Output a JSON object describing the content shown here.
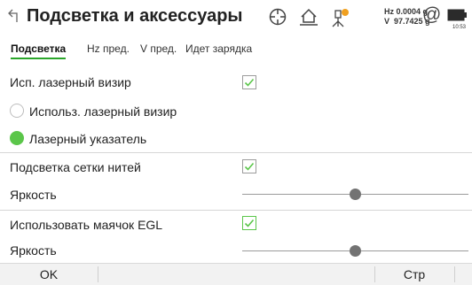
{
  "header": {
    "title": "Подсветка и аксессуары",
    "hz_line": "Hz 0.0004 g",
    "v_line": "V  97.7425 g",
    "at_symbol": "@",
    "battery_text": "10:53"
  },
  "tabs": [
    {
      "label": "Подсветка",
      "active": true
    },
    {
      "label": "Hz пред.",
      "active": false
    },
    {
      "label": "V пред.",
      "active": false
    },
    {
      "label": "Идет зарядка",
      "active": false
    }
  ],
  "settings": {
    "use_laser_label": "Исп. лазерный визир",
    "use_laser_checked": true,
    "radio_laser_sight": "Использ. лазерный визир",
    "radio_laser_pointer": "Лазерный указатель",
    "selected_radio": "laser_pointer",
    "reticle_label": "Подсветка сетки нитей",
    "reticle_checked": true,
    "reticle_brightness_label": "Яркость",
    "reticle_brightness_level": 0.5,
    "egl_label": "Использовать маячок EGL",
    "egl_checked": true,
    "egl_brightness_label": "Яркость",
    "egl_brightness_level": 0.5
  },
  "softkeys": {
    "ok": "OK",
    "page": "Стр"
  },
  "colors": {
    "accent": "#5bc64a",
    "check": "#5bc64a"
  }
}
